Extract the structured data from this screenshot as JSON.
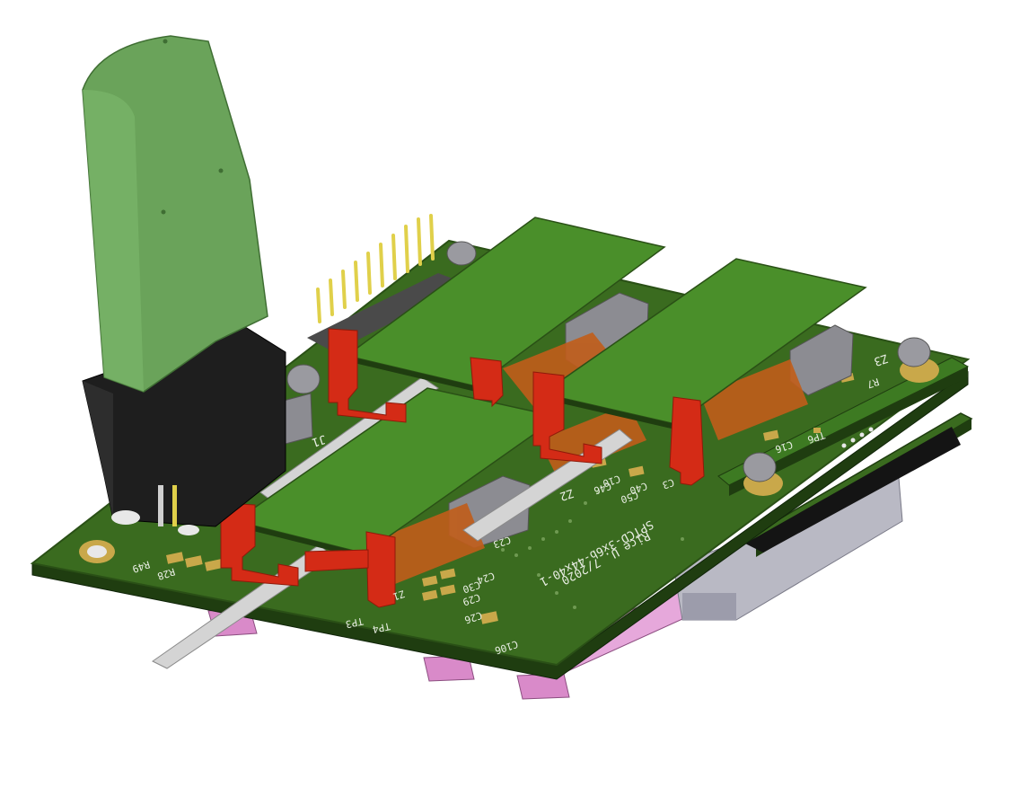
{
  "scene": {
    "description_visible_text": true,
    "colors": {
      "pcb_top": "#3a6b1f",
      "pcb_edge": "#2a5016",
      "pcb_side": "#1f3d10",
      "daughter_board": "#4a8f2a",
      "connector_red": "#d42b16",
      "flex_copper": "#c15d1a",
      "pad_gold": "#c9a84a",
      "ribbon": "#cfcfcf",
      "green_plug": "#6aa35a",
      "black_housing": "#1e1e1e",
      "pin_gold": "#e0d04a",
      "pink_conn": "#d98ac9",
      "heatsink": "#b9b9c4"
    },
    "silkscreen": {
      "board_label": "SPTCD-3x6b-44x40-1",
      "revision": "Rice U. 7/2020",
      "z1": "Z1",
      "z2": "Z2",
      "z3": "Z3",
      "j1": "J1",
      "tp6": "TP6",
      "tp4": "TP4",
      "tp3": "TP3",
      "r7": "R7",
      "r28": "R28",
      "r49": "R49",
      "c3": "C3",
      "c10": "C10",
      "c16": "C16",
      "c23": "C23",
      "c24": "C24",
      "c26": "C26",
      "c29": "C29",
      "c30": "C30",
      "c40": "C40",
      "c46": "C46",
      "c50": "C50",
      "c106": "C106"
    },
    "icons": [
      "pcb-board-3d",
      "terminal-plug",
      "pin-header",
      "edge-connector",
      "flex-cable"
    ]
  }
}
